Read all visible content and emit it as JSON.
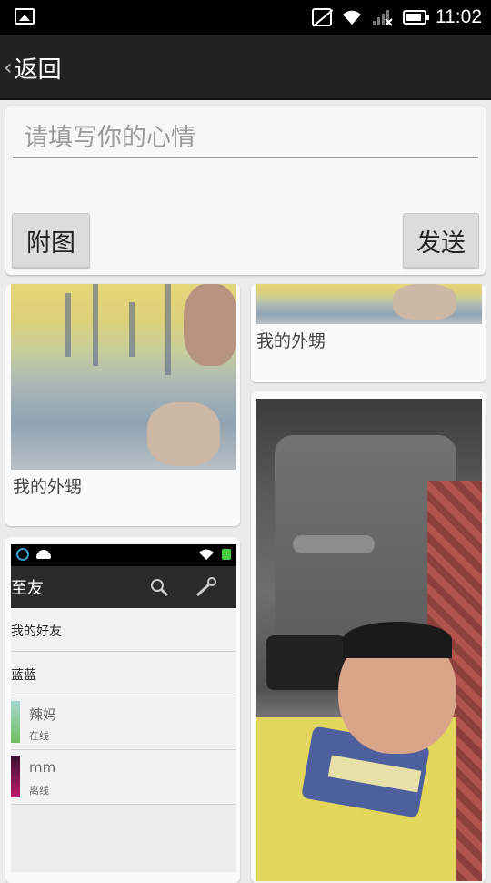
{
  "status_bar": {
    "time": "11:02",
    "icons": [
      "gallery-notification-icon",
      "vibrate-off-icon",
      "wifi-icon",
      "signal-icon",
      "battery-icon"
    ]
  },
  "app_bar": {
    "back_chevron": "‹",
    "back_label": "返回"
  },
  "composer": {
    "placeholder": "请填写你的心情",
    "attach_label": "附图",
    "send_label": "发送"
  },
  "feed": {
    "cards": [
      {
        "caption": "我的外甥",
        "image": "boy-shirt-photo"
      },
      {
        "caption": "我的外甥",
        "image": "boy-shirt-photo-cropped"
      },
      {
        "caption": "",
        "image": "friends-list-screenshot"
      },
      {
        "caption": "",
        "image": "boy-sleeping-in-car-photo"
      }
    ]
  },
  "mini_screenshot": {
    "title": "至友",
    "group_my_friends": "我的好友",
    "group_blue": "蓝蓝",
    "contacts": [
      {
        "name": "辣妈",
        "status": "在线"
      },
      {
        "name": "mm",
        "status": "离线"
      }
    ]
  },
  "colors": {
    "app_bar_bg": "#222222",
    "page_bg": "#ebebeb",
    "card_bg": "#fafafa",
    "button_bg": "#dcdcdc"
  }
}
